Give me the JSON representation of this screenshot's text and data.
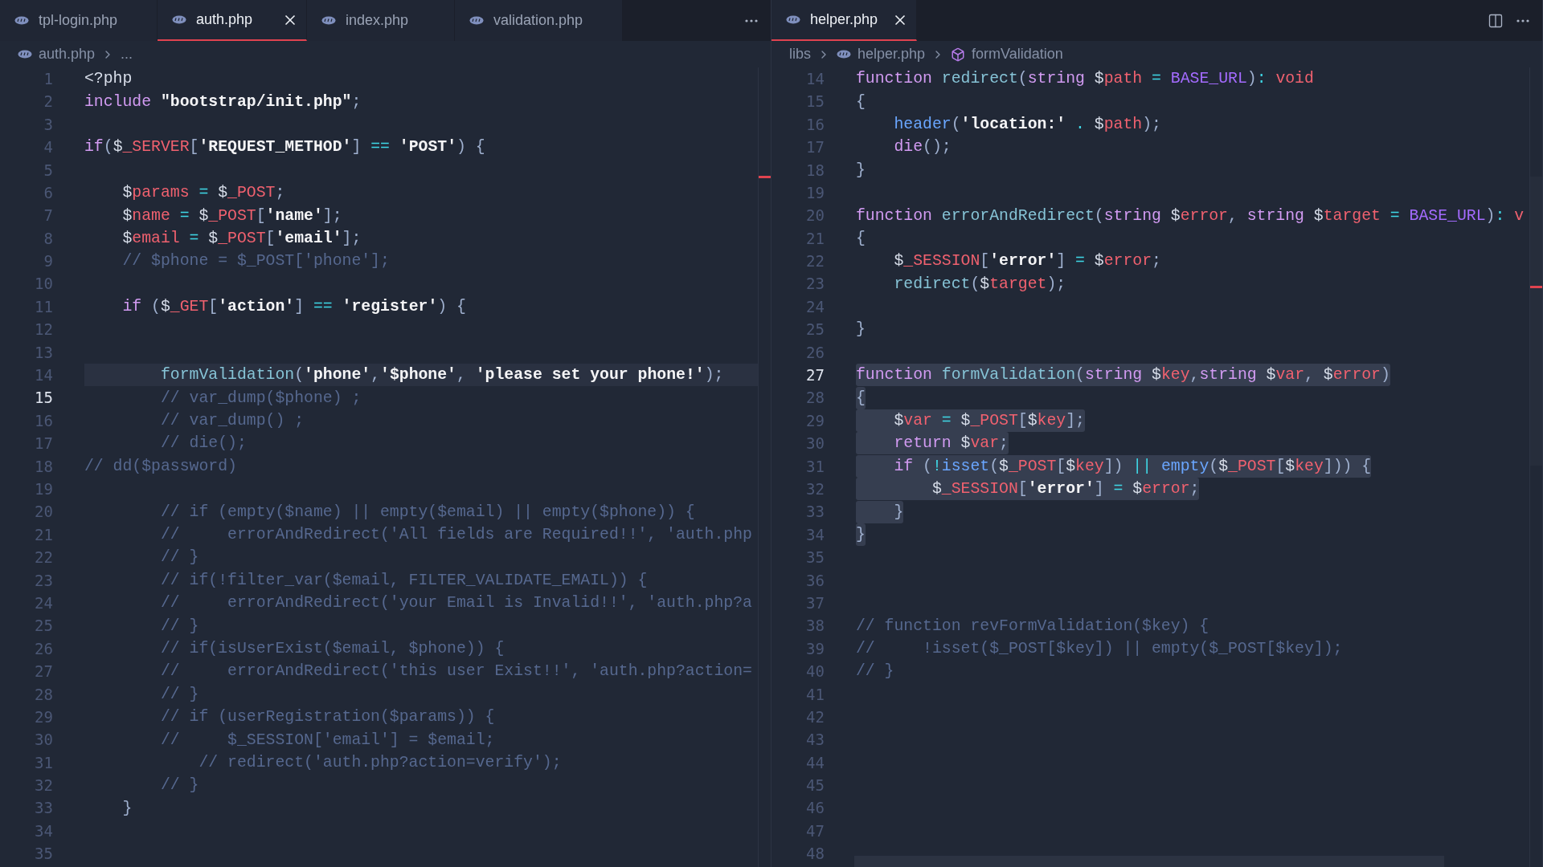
{
  "panes": [
    {
      "tabs": [
        {
          "label": "tpl-login.php",
          "selected": false
        },
        {
          "label": "auth.php",
          "selected": true
        },
        {
          "label": "index.php",
          "selected": false
        },
        {
          "label": "validation.php",
          "selected": false
        }
      ],
      "actions": [
        {
          "kind": "more"
        }
      ],
      "breadcrumb": [
        {
          "label": "auth.php",
          "kind": "file"
        },
        {
          "label": "...",
          "kind": "more"
        }
      ],
      "lines": [
        {
          "n": "1",
          "tokens": [
            {
              "text": "<?php",
              "kind": "t"
            }
          ]
        },
        {
          "n": "2",
          "tokens": [
            {
              "text": "include ",
              "kind": "kw"
            },
            {
              "text": "\"bootstrap/init.php\"",
              "kind": "s"
            },
            {
              "text": ";",
              "kind": "p"
            }
          ]
        },
        {
          "n": "3"
        },
        {
          "n": "4",
          "tokens": [
            {
              "text": "if",
              "kind": "kw"
            },
            {
              "text": "(",
              "kind": "p"
            },
            {
              "text": "$",
              "kind": "t"
            },
            {
              "text": "_SERVER",
              "kind": "v"
            },
            {
              "text": "[",
              "kind": "p"
            },
            {
              "text": "'REQUEST_METHOD'",
              "kind": "s"
            },
            {
              "text": "]",
              "kind": "p"
            },
            {
              "text": " == ",
              "kind": "op"
            },
            {
              "text": "'POST'",
              "kind": "s"
            },
            {
              "text": ") {",
              "kind": "p"
            }
          ]
        },
        {
          "n": "5"
        },
        {
          "n": "6",
          "tokens": [
            {
              "text": "    $",
              "kind": "t"
            },
            {
              "text": "params",
              "kind": "v"
            },
            {
              "text": " = ",
              "kind": "op"
            },
            {
              "text": "$",
              "kind": "t"
            },
            {
              "text": "_POST",
              "kind": "v"
            },
            {
              "text": ";",
              "kind": "p"
            }
          ]
        },
        {
          "n": "7",
          "tokens": [
            {
              "text": "    $",
              "kind": "t"
            },
            {
              "text": "name",
              "kind": "v"
            },
            {
              "text": " = ",
              "kind": "op"
            },
            {
              "text": "$",
              "kind": "t"
            },
            {
              "text": "_POST",
              "kind": "v"
            },
            {
              "text": "[",
              "kind": "p"
            },
            {
              "text": "'name'",
              "kind": "s"
            },
            {
              "text": "];",
              "kind": "p"
            }
          ]
        },
        {
          "n": "8",
          "tokens": [
            {
              "text": "    $",
              "kind": "t"
            },
            {
              "text": "email",
              "kind": "v"
            },
            {
              "text": " = ",
              "kind": "op"
            },
            {
              "text": "$",
              "kind": "t"
            },
            {
              "text": "_POST",
              "kind": "v"
            },
            {
              "text": "[",
              "kind": "p"
            },
            {
              "text": "'email'",
              "kind": "s"
            },
            {
              "text": "];",
              "kind": "p"
            }
          ]
        },
        {
          "n": "9",
          "tokens": [
            {
              "text": "    // $phone = $_POST['phone'];",
              "kind": "cm"
            }
          ]
        },
        {
          "n": "10"
        },
        {
          "n": "11",
          "tokens": [
            {
              "text": "    if",
              "kind": "kw"
            },
            {
              "text": " (",
              "kind": "p"
            },
            {
              "text": "$",
              "kind": "t"
            },
            {
              "text": "_GET",
              "kind": "v"
            },
            {
              "text": "[",
              "kind": "p"
            },
            {
              "text": "'action'",
              "kind": "s"
            },
            {
              "text": "]",
              "kind": "p"
            },
            {
              "text": " == ",
              "kind": "op"
            },
            {
              "text": "'register'",
              "kind": "s"
            },
            {
              "text": ") {",
              "kind": "p"
            }
          ]
        },
        {
          "n": "12"
        },
        {
          "n": "13"
        },
        {
          "n": "14",
          "highlight": true,
          "tokens": [
            {
              "text": "        formValidation",
              "kind": "fn"
            },
            {
              "text": "(",
              "kind": "p"
            },
            {
              "text": "'phone'",
              "kind": "s"
            },
            {
              "text": ",",
              "kind": "p"
            },
            {
              "text": "'$phone'",
              "kind": "s"
            },
            {
              "text": ", ",
              "kind": "p"
            },
            {
              "text": "'please set your phone!'",
              "kind": "s"
            },
            {
              "text": ");",
              "kind": "p"
            }
          ]
        },
        {
          "n": "15",
          "active": true,
          "tokens": [
            {
              "text": "        // var_dump($phone) ;",
              "kind": "cm"
            }
          ]
        },
        {
          "n": "16",
          "tokens": [
            {
              "text": "        // var_dump() ;",
              "kind": "cm"
            }
          ]
        },
        {
          "n": "17",
          "tokens": [
            {
              "text": "        // die();",
              "kind": "cm"
            }
          ]
        },
        {
          "n": "18",
          "tokens": [
            {
              "text": "// dd($password)",
              "kind": "cm"
            }
          ]
        },
        {
          "n": "19"
        },
        {
          "n": "20",
          "tokens": [
            {
              "text": "        // if (empty($name) || empty($email) || empty($phone)) {",
              "kind": "cm"
            }
          ]
        },
        {
          "n": "21",
          "tokens": [
            {
              "text": "        //     errorAndRedirect('All fields are Required!!', 'auth.php",
              "kind": "cm"
            }
          ]
        },
        {
          "n": "22",
          "tokens": [
            {
              "text": "        // }",
              "kind": "cm"
            }
          ]
        },
        {
          "n": "23",
          "tokens": [
            {
              "text": "        // if(!filter_var($email, FILTER_VALIDATE_EMAIL)) {",
              "kind": "cm"
            }
          ]
        },
        {
          "n": "24",
          "tokens": [
            {
              "text": "        //     errorAndRedirect('your Email is Invalid!!', 'auth.php?a",
              "kind": "cm"
            }
          ]
        },
        {
          "n": "25",
          "tokens": [
            {
              "text": "        // }",
              "kind": "cm"
            }
          ]
        },
        {
          "n": "26",
          "tokens": [
            {
              "text": "        // if(isUserExist($email, $phone)) {",
              "kind": "cm"
            }
          ]
        },
        {
          "n": "27",
          "tokens": [
            {
              "text": "        //     errorAndRedirect('this user Exist!!', 'auth.php?action=",
              "kind": "cm"
            }
          ]
        },
        {
          "n": "28",
          "tokens": [
            {
              "text": "        // }",
              "kind": "cm"
            }
          ]
        },
        {
          "n": "29",
          "tokens": [
            {
              "text": "        // if (userRegistration($params)) {",
              "kind": "cm"
            }
          ]
        },
        {
          "n": "30",
          "tokens": [
            {
              "text": "        //     $_SESSION['email'] = $email;",
              "kind": "cm"
            }
          ]
        },
        {
          "n": "31",
          "tokens": [
            {
              "text": "            // redirect('auth.php?action=verify');",
              "kind": "cm"
            }
          ]
        },
        {
          "n": "32",
          "tokens": [
            {
              "text": "        // }",
              "kind": "cm"
            }
          ]
        },
        {
          "n": "33",
          "tokens": [
            {
              "text": "    }",
              "kind": "p"
            }
          ]
        },
        {
          "n": "34"
        },
        {
          "n": "35"
        }
      ]
    },
    {
      "tabs": [
        {
          "label": "helper.php",
          "selected": true
        }
      ],
      "actions": [
        {
          "kind": "split"
        },
        {
          "kind": "more"
        }
      ],
      "breadcrumb": [
        {
          "label": "libs",
          "kind": "folder"
        },
        {
          "label": "helper.php",
          "kind": "file"
        },
        {
          "label": "formValidation",
          "kind": "symbol"
        }
      ],
      "lines": [
        {
          "n": "14",
          "tokens": [
            {
              "text": "function ",
              "kind": "kw"
            },
            {
              "text": "redirect",
              "kind": "fn"
            },
            {
              "text": "(",
              "kind": "p"
            },
            {
              "text": "string",
              "kind": "kw"
            },
            {
              "text": " $",
              "kind": "t"
            },
            {
              "text": "path",
              "kind": "v"
            },
            {
              "text": " = ",
              "kind": "op"
            },
            {
              "text": "BASE_URL",
              "kind": "c"
            },
            {
              "text": ")",
              "kind": "p"
            },
            {
              "text": ": ",
              "kind": "op"
            },
            {
              "text": "void",
              "kind": "r"
            }
          ]
        },
        {
          "n": "15",
          "tokens": [
            {
              "text": "{",
              "kind": "p"
            }
          ]
        },
        {
          "n": "16",
          "tokens": [
            {
              "text": "    header",
              "kind": "bi"
            },
            {
              "text": "(",
              "kind": "p"
            },
            {
              "text": "'location:'",
              "kind": "s"
            },
            {
              "text": " . ",
              "kind": "op"
            },
            {
              "text": "$",
              "kind": "t"
            },
            {
              "text": "path",
              "kind": "v"
            },
            {
              "text": ");",
              "kind": "p"
            }
          ]
        },
        {
          "n": "17",
          "tokens": [
            {
              "text": "    die",
              "kind": "kw"
            },
            {
              "text": "();",
              "kind": "p"
            }
          ]
        },
        {
          "n": "18",
          "tokens": [
            {
              "text": "}",
              "kind": "p"
            }
          ]
        },
        {
          "n": "19"
        },
        {
          "n": "20",
          "tokens": [
            {
              "text": "function ",
              "kind": "kw"
            },
            {
              "text": "errorAndRedirect",
              "kind": "fn"
            },
            {
              "text": "(",
              "kind": "p"
            },
            {
              "text": "string",
              "kind": "kw"
            },
            {
              "text": " $",
              "kind": "t"
            },
            {
              "text": "error",
              "kind": "v"
            },
            {
              "text": ", ",
              "kind": "p"
            },
            {
              "text": "string",
              "kind": "kw"
            },
            {
              "text": " $",
              "kind": "t"
            },
            {
              "text": "target",
              "kind": "v"
            },
            {
              "text": " = ",
              "kind": "op"
            },
            {
              "text": "BASE_URL",
              "kind": "c"
            },
            {
              "text": ")",
              "kind": "p"
            },
            {
              "text": ": ",
              "kind": "op"
            },
            {
              "text": "v",
              "kind": "r"
            }
          ]
        },
        {
          "n": "21",
          "tokens": [
            {
              "text": "{",
              "kind": "p"
            }
          ]
        },
        {
          "n": "22",
          "tokens": [
            {
              "text": "    $",
              "kind": "t"
            },
            {
              "text": "_SESSION",
              "kind": "v"
            },
            {
              "text": "[",
              "kind": "p"
            },
            {
              "text": "'error'",
              "kind": "s"
            },
            {
              "text": "]",
              "kind": "p"
            },
            {
              "text": " = ",
              "kind": "op"
            },
            {
              "text": "$",
              "kind": "t"
            },
            {
              "text": "error",
              "kind": "v"
            },
            {
              "text": ";",
              "kind": "p"
            }
          ]
        },
        {
          "n": "23",
          "tokens": [
            {
              "text": "    redirect",
              "kind": "fn"
            },
            {
              "text": "(",
              "kind": "p"
            },
            {
              "text": "$",
              "kind": "t"
            },
            {
              "text": "target",
              "kind": "v"
            },
            {
              "text": ");",
              "kind": "p"
            }
          ]
        },
        {
          "n": "24"
        },
        {
          "n": "25",
          "tokens": [
            {
              "text": "}",
              "kind": "p"
            }
          ]
        },
        {
          "n": "26"
        },
        {
          "n": "27",
          "active": true,
          "selected": true,
          "tokens": [
            {
              "text": "function ",
              "kind": "kw"
            },
            {
              "text": "formValidation",
              "kind": "fn"
            },
            {
              "text": "(",
              "kind": "p"
            },
            {
              "text": "string",
              "kind": "kw"
            },
            {
              "text": " $",
              "kind": "t"
            },
            {
              "text": "key",
              "kind": "v"
            },
            {
              "text": ",",
              "kind": "p"
            },
            {
              "text": "string",
              "kind": "kw"
            },
            {
              "text": " $",
              "kind": "t"
            },
            {
              "text": "var",
              "kind": "v"
            },
            {
              "text": ", ",
              "kind": "p"
            },
            {
              "text": "$",
              "kind": "t"
            },
            {
              "text": "error",
              "kind": "v"
            },
            {
              "text": ")",
              "kind": "p"
            }
          ]
        },
        {
          "n": "28",
          "selected": true,
          "tokens": [
            {
              "text": "{",
              "kind": "p"
            }
          ]
        },
        {
          "n": "29",
          "selected": true,
          "tokens": [
            {
              "text": "    $",
              "kind": "t"
            },
            {
              "text": "var",
              "kind": "v"
            },
            {
              "text": " = ",
              "kind": "op"
            },
            {
              "text": "$",
              "kind": "t"
            },
            {
              "text": "_POST",
              "kind": "v"
            },
            {
              "text": "[",
              "kind": "p"
            },
            {
              "text": "$",
              "kind": "t"
            },
            {
              "text": "key",
              "kind": "v"
            },
            {
              "text": "];",
              "kind": "p"
            }
          ]
        },
        {
          "n": "30",
          "selected": true,
          "tokens": [
            {
              "text": "    return",
              "kind": "kw"
            },
            {
              "text": " $",
              "kind": "t"
            },
            {
              "text": "var",
              "kind": "v"
            },
            {
              "text": ";",
              "kind": "p"
            }
          ]
        },
        {
          "n": "31",
          "selected": true,
          "tokens": [
            {
              "text": "    if",
              "kind": "kw"
            },
            {
              "text": " (",
              "kind": "p"
            },
            {
              "text": "!",
              "kind": "op"
            },
            {
              "text": "isset",
              "kind": "bi"
            },
            {
              "text": "(",
              "kind": "p"
            },
            {
              "text": "$",
              "kind": "t"
            },
            {
              "text": "_POST",
              "kind": "v"
            },
            {
              "text": "[",
              "kind": "p"
            },
            {
              "text": "$",
              "kind": "t"
            },
            {
              "text": "key",
              "kind": "v"
            },
            {
              "text": "])",
              "kind": "p"
            },
            {
              "text": " || ",
              "kind": "op"
            },
            {
              "text": "empty",
              "kind": "bi"
            },
            {
              "text": "(",
              "kind": "p"
            },
            {
              "text": "$",
              "kind": "t"
            },
            {
              "text": "_POST",
              "kind": "v"
            },
            {
              "text": "[",
              "kind": "p"
            },
            {
              "text": "$",
              "kind": "t"
            },
            {
              "text": "key",
              "kind": "v"
            },
            {
              "text": "])) {",
              "kind": "p"
            }
          ]
        },
        {
          "n": "32",
          "selected": true,
          "tokens": [
            {
              "text": "        $",
              "kind": "t"
            },
            {
              "text": "_SESSION",
              "kind": "v"
            },
            {
              "text": "[",
              "kind": "p"
            },
            {
              "text": "'error'",
              "kind": "s"
            },
            {
              "text": "]",
              "kind": "p"
            },
            {
              "text": " = ",
              "kind": "op"
            },
            {
              "text": "$",
              "kind": "t"
            },
            {
              "text": "error",
              "kind": "v"
            },
            {
              "text": ";",
              "kind": "p"
            }
          ]
        },
        {
          "n": "33",
          "selected": true,
          "tokens": [
            {
              "text": "    }",
              "kind": "p"
            }
          ]
        },
        {
          "n": "34",
          "selected": true,
          "tokens": [
            {
              "text": "}",
              "kind": "p"
            }
          ]
        },
        {
          "n": "35"
        },
        {
          "n": "36"
        },
        {
          "n": "37"
        },
        {
          "n": "38",
          "tokens": [
            {
              "text": "// function revFormValidation($key) {",
              "kind": "cm"
            }
          ]
        },
        {
          "n": "39",
          "tokens": [
            {
              "text": "//     !isset($_POST[$key]) || empty($_POST[$key]);",
              "kind": "cm"
            }
          ]
        },
        {
          "n": "40",
          "tokens": [
            {
              "text": "// }",
              "kind": "cm"
            }
          ]
        },
        {
          "n": "41"
        },
        {
          "n": "42"
        },
        {
          "n": "43"
        },
        {
          "n": "44"
        },
        {
          "n": "45"
        },
        {
          "n": "46"
        },
        {
          "n": "47"
        },
        {
          "n": "48"
        }
      ]
    }
  ]
}
